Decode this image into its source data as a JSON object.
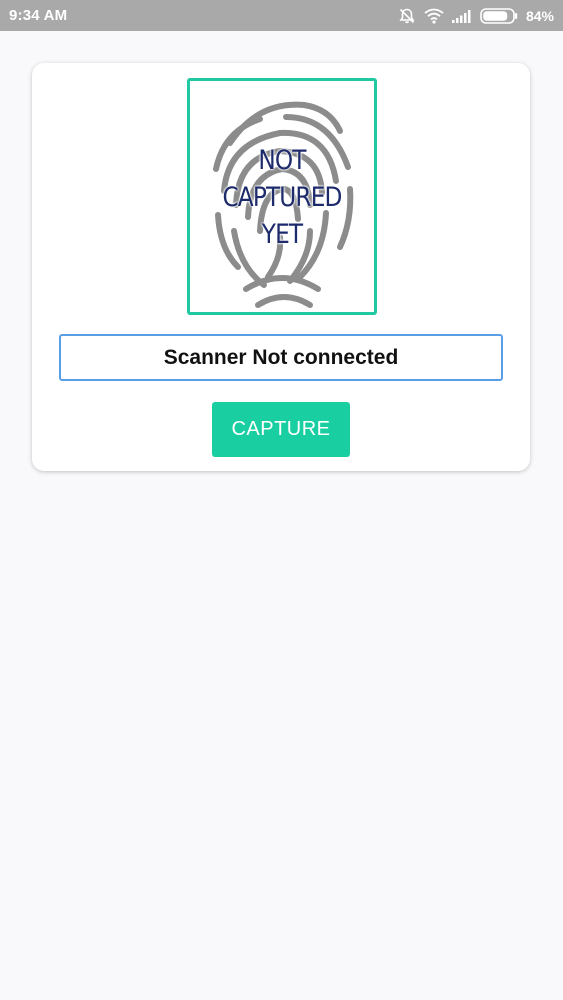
{
  "status_bar": {
    "time": "9:34 AM",
    "battery_percent": "84%",
    "battery_level": 0.84,
    "icons": [
      "alarm-off-icon",
      "wifi-icon",
      "signal-icon",
      "battery-icon"
    ]
  },
  "fingerprint": {
    "overlay_lines": [
      "NOT",
      "CAPTURED",
      "YET"
    ],
    "frame_color": "#20c9a2",
    "icon": "fingerprint-icon"
  },
  "scanner_status": "Scanner Not connected",
  "capture_button": {
    "label": "CAPTURE",
    "color": "#19cfa2"
  },
  "colors": {
    "accent": "#19cfa2",
    "field_border": "#5a9ee8",
    "status_bar": "#a9a9a9",
    "overlay_text": "#1d2a6b"
  }
}
